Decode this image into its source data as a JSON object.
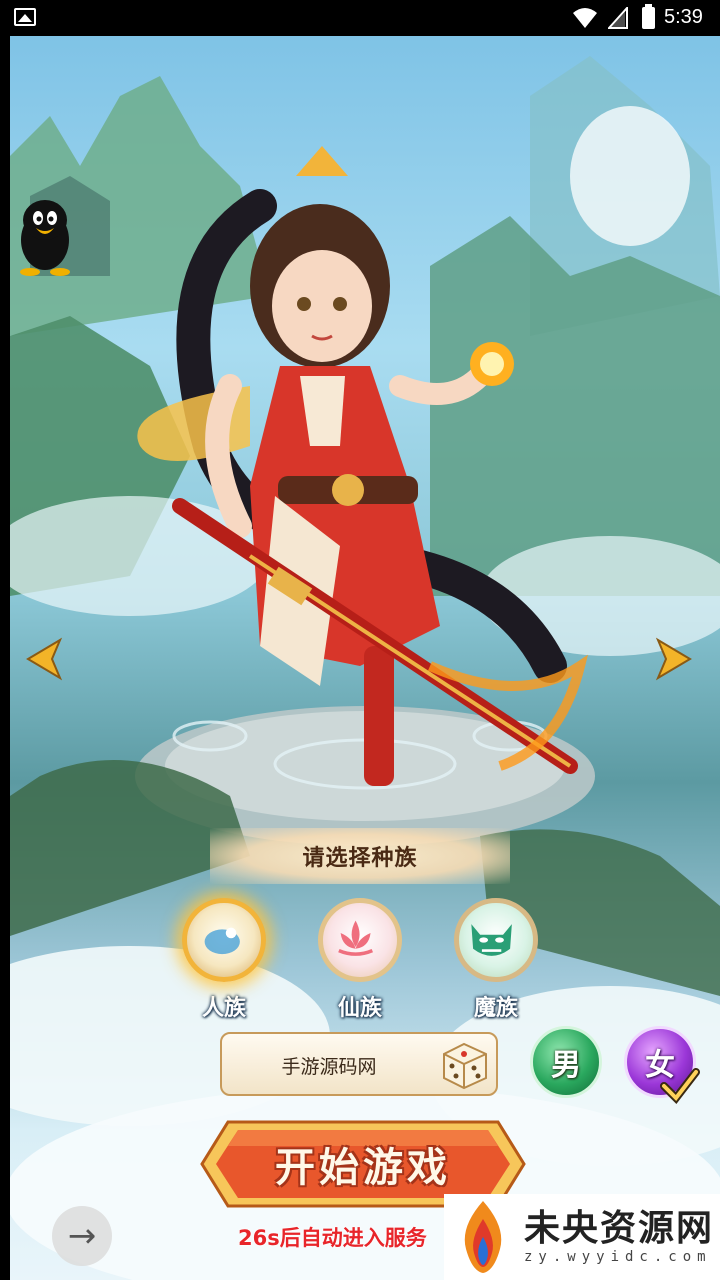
{
  "status_bar": {
    "time": "5:39"
  },
  "screen": {
    "race_prompt": "请选择种族",
    "races": [
      {
        "label": "人族",
        "selected": true
      },
      {
        "label": "仙族",
        "selected": false
      },
      {
        "label": "魔族",
        "selected": false
      }
    ],
    "character_name": "手游源码网",
    "gender": {
      "male_label": "男",
      "female_label": "女",
      "selected": "女"
    },
    "start_label": "开始游戏",
    "auto_enter_text": "26s后自动进入服务",
    "next_icon": "→"
  },
  "watermark": {
    "main": "未央资源网",
    "sub": "zy.wyyidc.com"
  },
  "colors": {
    "start_button": "#e8572c",
    "auto_enter_text": "#e8252a",
    "selected_race_glow": "#ffc43c"
  }
}
